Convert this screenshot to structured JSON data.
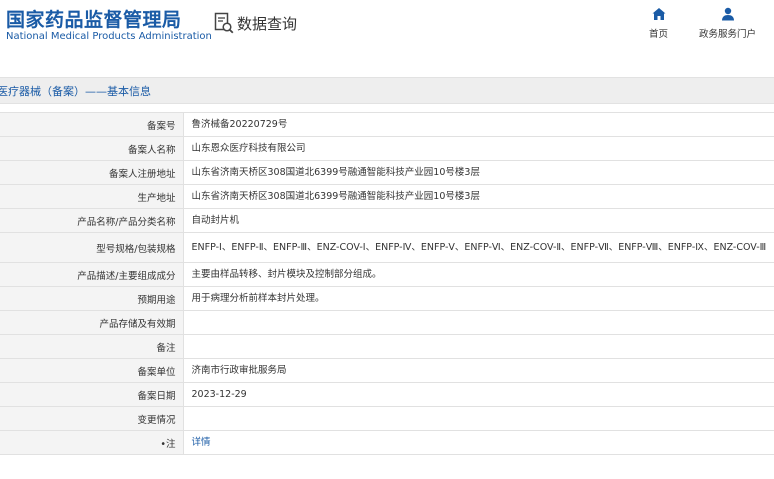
{
  "header": {
    "logo_cn": "国家药品监督管理局",
    "logo_en": "National Medical Products Administration",
    "query_label": "数据查询",
    "nav": [
      {
        "label": "首页",
        "icon": "home-icon"
      },
      {
        "label": "政务服务门户",
        "icon": "user-icon"
      }
    ]
  },
  "section_title": "医疗器械（备案）——基本信息",
  "colors": {
    "brand": "#1a5ba6",
    "label_bg": "#f4f4f4",
    "border": "#e1e1e1"
  },
  "rows": [
    {
      "label": "备案号",
      "value": "鲁济械备20220729号"
    },
    {
      "label": "备案人名称",
      "value": "山东恩众医疗科技有限公司"
    },
    {
      "label": "备案人注册地址",
      "value": "山东省济南天桥区308国道北6399号融通智能科技产业园10号楼3层"
    },
    {
      "label": "生产地址",
      "value": "山东省济南天桥区308国道北6399号融通智能科技产业园10号楼3层"
    },
    {
      "label": "产品名称/产品分类名称",
      "value": "自动封片机"
    },
    {
      "label": "型号规格/包装规格",
      "value": "ENFP-Ⅰ、ENFP-Ⅱ、ENFP-Ⅲ、ENZ-COV-Ⅰ、ENFP-Ⅳ、ENFP-Ⅴ、ENFP-Ⅵ、ENZ-COV-Ⅱ、ENFP-Ⅶ、ENFP-Ⅷ、ENFP-Ⅸ、ENZ-COV-Ⅲ"
    },
    {
      "label": "产品描述/主要组成成分",
      "value": "主要由样品转移、封片模块及控制部分组成。"
    },
    {
      "label": "预期用途",
      "value": "用于病理分析前样本封片处理。"
    },
    {
      "label": "产品存储及有效期",
      "value": ""
    },
    {
      "label": "备注",
      "value": ""
    },
    {
      "label": "备案单位",
      "value": "济南市行政审批服务局"
    },
    {
      "label": "备案日期",
      "value": "2023-12-29"
    },
    {
      "label": "变更情况",
      "value": ""
    },
    {
      "label": "注",
      "value": "详情"
    }
  ]
}
